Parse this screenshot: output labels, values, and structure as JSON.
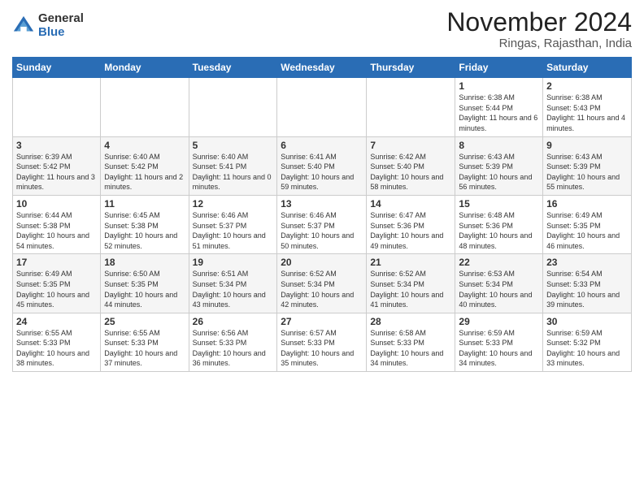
{
  "logo": {
    "general": "General",
    "blue": "Blue"
  },
  "header": {
    "month": "November 2024",
    "location": "Ringas, Rajasthan, India"
  },
  "weekdays": [
    "Sunday",
    "Monday",
    "Tuesday",
    "Wednesday",
    "Thursday",
    "Friday",
    "Saturday"
  ],
  "weeks": [
    [
      {
        "day": "",
        "info": ""
      },
      {
        "day": "",
        "info": ""
      },
      {
        "day": "",
        "info": ""
      },
      {
        "day": "",
        "info": ""
      },
      {
        "day": "",
        "info": ""
      },
      {
        "day": "1",
        "info": "Sunrise: 6:38 AM\nSunset: 5:44 PM\nDaylight: 11 hours and 6 minutes."
      },
      {
        "day": "2",
        "info": "Sunrise: 6:38 AM\nSunset: 5:43 PM\nDaylight: 11 hours and 4 minutes."
      }
    ],
    [
      {
        "day": "3",
        "info": "Sunrise: 6:39 AM\nSunset: 5:42 PM\nDaylight: 11 hours and 3 minutes."
      },
      {
        "day": "4",
        "info": "Sunrise: 6:40 AM\nSunset: 5:42 PM\nDaylight: 11 hours and 2 minutes."
      },
      {
        "day": "5",
        "info": "Sunrise: 6:40 AM\nSunset: 5:41 PM\nDaylight: 11 hours and 0 minutes."
      },
      {
        "day": "6",
        "info": "Sunrise: 6:41 AM\nSunset: 5:40 PM\nDaylight: 10 hours and 59 minutes."
      },
      {
        "day": "7",
        "info": "Sunrise: 6:42 AM\nSunset: 5:40 PM\nDaylight: 10 hours and 58 minutes."
      },
      {
        "day": "8",
        "info": "Sunrise: 6:43 AM\nSunset: 5:39 PM\nDaylight: 10 hours and 56 minutes."
      },
      {
        "day": "9",
        "info": "Sunrise: 6:43 AM\nSunset: 5:39 PM\nDaylight: 10 hours and 55 minutes."
      }
    ],
    [
      {
        "day": "10",
        "info": "Sunrise: 6:44 AM\nSunset: 5:38 PM\nDaylight: 10 hours and 54 minutes."
      },
      {
        "day": "11",
        "info": "Sunrise: 6:45 AM\nSunset: 5:38 PM\nDaylight: 10 hours and 52 minutes."
      },
      {
        "day": "12",
        "info": "Sunrise: 6:46 AM\nSunset: 5:37 PM\nDaylight: 10 hours and 51 minutes."
      },
      {
        "day": "13",
        "info": "Sunrise: 6:46 AM\nSunset: 5:37 PM\nDaylight: 10 hours and 50 minutes."
      },
      {
        "day": "14",
        "info": "Sunrise: 6:47 AM\nSunset: 5:36 PM\nDaylight: 10 hours and 49 minutes."
      },
      {
        "day": "15",
        "info": "Sunrise: 6:48 AM\nSunset: 5:36 PM\nDaylight: 10 hours and 48 minutes."
      },
      {
        "day": "16",
        "info": "Sunrise: 6:49 AM\nSunset: 5:35 PM\nDaylight: 10 hours and 46 minutes."
      }
    ],
    [
      {
        "day": "17",
        "info": "Sunrise: 6:49 AM\nSunset: 5:35 PM\nDaylight: 10 hours and 45 minutes."
      },
      {
        "day": "18",
        "info": "Sunrise: 6:50 AM\nSunset: 5:35 PM\nDaylight: 10 hours and 44 minutes."
      },
      {
        "day": "19",
        "info": "Sunrise: 6:51 AM\nSunset: 5:34 PM\nDaylight: 10 hours and 43 minutes."
      },
      {
        "day": "20",
        "info": "Sunrise: 6:52 AM\nSunset: 5:34 PM\nDaylight: 10 hours and 42 minutes."
      },
      {
        "day": "21",
        "info": "Sunrise: 6:52 AM\nSunset: 5:34 PM\nDaylight: 10 hours and 41 minutes."
      },
      {
        "day": "22",
        "info": "Sunrise: 6:53 AM\nSunset: 5:34 PM\nDaylight: 10 hours and 40 minutes."
      },
      {
        "day": "23",
        "info": "Sunrise: 6:54 AM\nSunset: 5:33 PM\nDaylight: 10 hours and 39 minutes."
      }
    ],
    [
      {
        "day": "24",
        "info": "Sunrise: 6:55 AM\nSunset: 5:33 PM\nDaylight: 10 hours and 38 minutes."
      },
      {
        "day": "25",
        "info": "Sunrise: 6:55 AM\nSunset: 5:33 PM\nDaylight: 10 hours and 37 minutes."
      },
      {
        "day": "26",
        "info": "Sunrise: 6:56 AM\nSunset: 5:33 PM\nDaylight: 10 hours and 36 minutes."
      },
      {
        "day": "27",
        "info": "Sunrise: 6:57 AM\nSunset: 5:33 PM\nDaylight: 10 hours and 35 minutes."
      },
      {
        "day": "28",
        "info": "Sunrise: 6:58 AM\nSunset: 5:33 PM\nDaylight: 10 hours and 34 minutes."
      },
      {
        "day": "29",
        "info": "Sunrise: 6:59 AM\nSunset: 5:33 PM\nDaylight: 10 hours and 34 minutes."
      },
      {
        "day": "30",
        "info": "Sunrise: 6:59 AM\nSunset: 5:32 PM\nDaylight: 10 hours and 33 minutes."
      }
    ]
  ]
}
